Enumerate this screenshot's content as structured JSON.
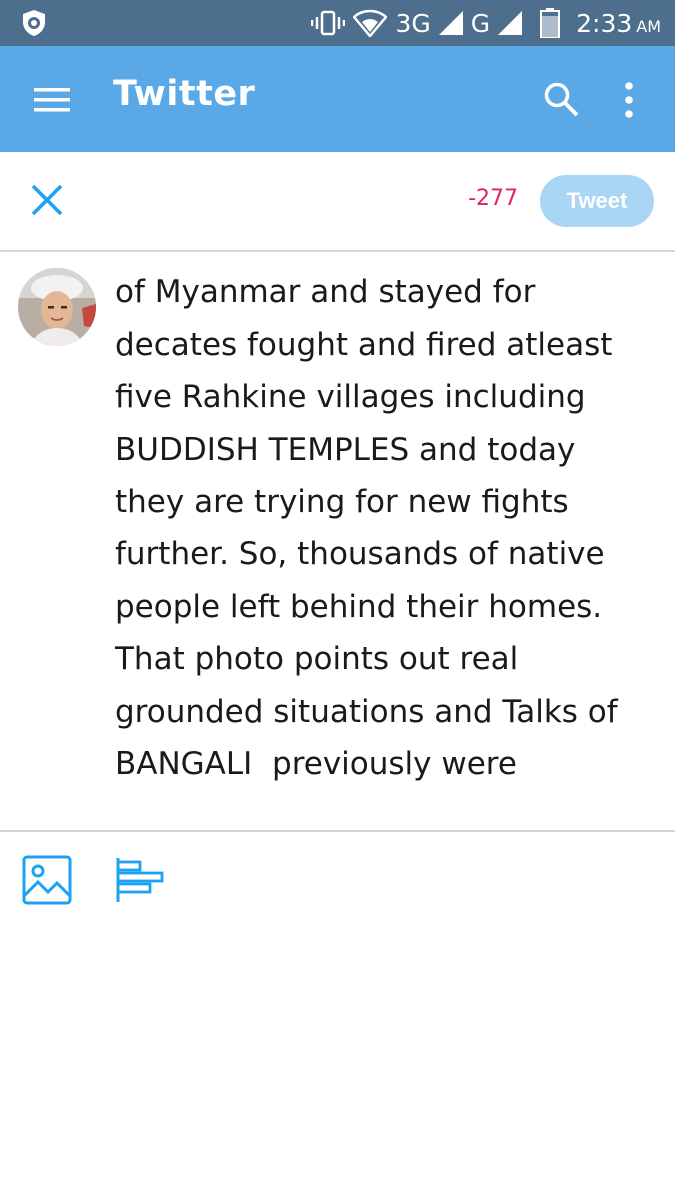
{
  "status_bar": {
    "network": "3G",
    "network2": "G",
    "time": "2:33",
    "ampm": "AM"
  },
  "app_bar": {
    "title": "Twitter"
  },
  "compose": {
    "char_count": "-277",
    "tweet_button": "Tweet",
    "text_lines": [
      "",
      "of Myanmar and stayed for",
      "decates fought and fired atleast",
      "five Rahkine villages including",
      "BUDDISH TEMPLES and today",
      "they are trying for new fights",
      "further. So, thousands of native",
      "people left behind their homes.",
      "That photo points out real",
      "grounded situations and Talks of",
      "BANGALI  previously were"
    ]
  },
  "colors": {
    "status_bar": "#4d6e8c",
    "app_bar": "#5aa9e6",
    "accent": "#1da1f2",
    "count_negative": "#e0245e",
    "tweet_button_disabled": "#a9d6f5"
  },
  "icons": {
    "status_left": "shield-icon",
    "menu": "hamburger-menu-icon",
    "search": "search-icon",
    "more": "more-vertical-icon",
    "close": "close-icon",
    "image": "image-icon",
    "poll": "poll-icon"
  }
}
